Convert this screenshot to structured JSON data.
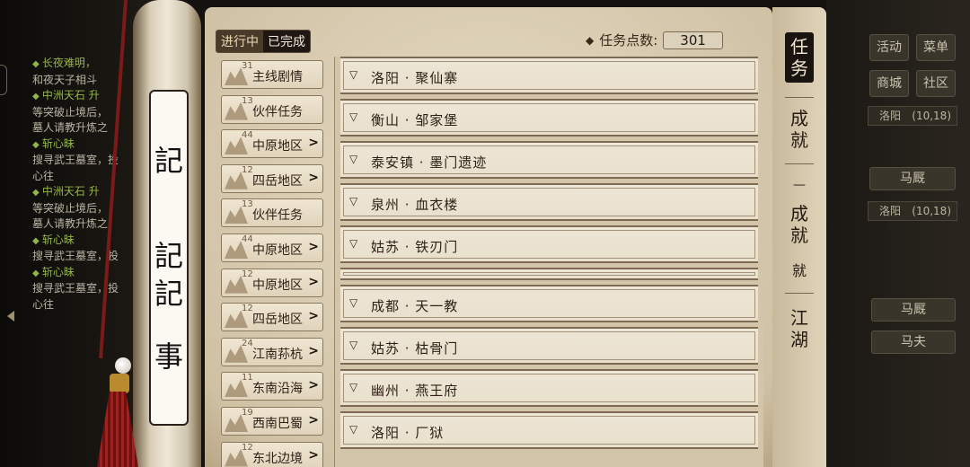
{
  "log": [
    {
      "type": "g",
      "text": "长夜难明，"
    },
    {
      "type": "w",
      "text": "和夜天子相斗"
    },
    {
      "type": "g",
      "text": "中洲天石 升"
    },
    {
      "type": "w",
      "text": "等突破止境后，"
    },
    {
      "type": "w",
      "text": "墓人请教升炼之"
    },
    {
      "type": "g",
      "text": "斩心昧"
    },
    {
      "type": "w",
      "text": "搜寻武王墓室，投"
    },
    {
      "type": "w",
      "text": "心往"
    },
    {
      "type": "g",
      "text": "中洲天石 升"
    },
    {
      "type": "w",
      "text": "等突破止境后，"
    },
    {
      "type": "w",
      "text": "墓人请教升炼之"
    },
    {
      "type": "g",
      "text": "斩心昧"
    },
    {
      "type": "w",
      "text": "搜寻武王墓室，投"
    },
    {
      "type": "g",
      "text": "斩心昧"
    },
    {
      "type": "w",
      "text": "搜寻武王墓室，投"
    },
    {
      "type": "w",
      "text": "心往"
    }
  ],
  "scroll": {
    "chars": [
      "記",
      "記",
      "記",
      "事"
    ]
  },
  "status_tabs": {
    "active": "进行中",
    "done": "已完成"
  },
  "points": {
    "label": "任务点数:",
    "value": "301"
  },
  "categories": [
    {
      "num": "31",
      "name": "主线剧情",
      "chev": ""
    },
    {
      "num": "13",
      "name": "伙伴任务",
      "chev": ""
    },
    {
      "num": "44",
      "name": "中原地区",
      "chev": ">"
    },
    {
      "num": "12",
      "name": "四岳地区",
      "chev": ">"
    },
    {
      "num": "13",
      "name": "伙伴任务",
      "chev": ""
    },
    {
      "num": "44",
      "name": "中原地区",
      "chev": ">"
    },
    {
      "num": "12",
      "name": "中原地区",
      "chev": ">"
    },
    {
      "num": "12",
      "name": "四岳地区",
      "chev": ">"
    },
    {
      "num": "24",
      "name": "江南荪杭",
      "chev": ">"
    },
    {
      "num": "11",
      "name": "东南沿海",
      "chev": ">"
    },
    {
      "num": "19",
      "name": "西南巴蜀",
      "chev": ">"
    },
    {
      "num": "12",
      "name": "东北边境",
      "chev": ">"
    }
  ],
  "locations": [
    {
      "text": "洛阳 · 聚仙寨"
    },
    {
      "text": "衡山 · 邹家堡"
    },
    {
      "text": "泰安镇 · 墨门遗迹"
    },
    {
      "text": "泉州 · 血衣楼"
    },
    {
      "text": "姑苏 · 铁刃门"
    },
    {
      "text": ""
    },
    {
      "text": "成都 · 天一教"
    },
    {
      "text": "姑苏 · 枯骨门"
    },
    {
      "text": "幽州 · 燕王府"
    },
    {
      "text": "洛阳 · 厂狱"
    }
  ],
  "right_tabs": [
    "任务",
    "成就",
    "成就",
    "江湖"
  ],
  "right_tab_fragments": [
    "—",
    "就"
  ],
  "right_ui": {
    "buttons": [
      "活动",
      "菜单",
      "商城",
      "社区"
    ],
    "coords_label": "洛阳",
    "coords_value": "(10,18)",
    "horse_1": "马厩",
    "horse_2": "马厩",
    "groom": "马夫"
  }
}
